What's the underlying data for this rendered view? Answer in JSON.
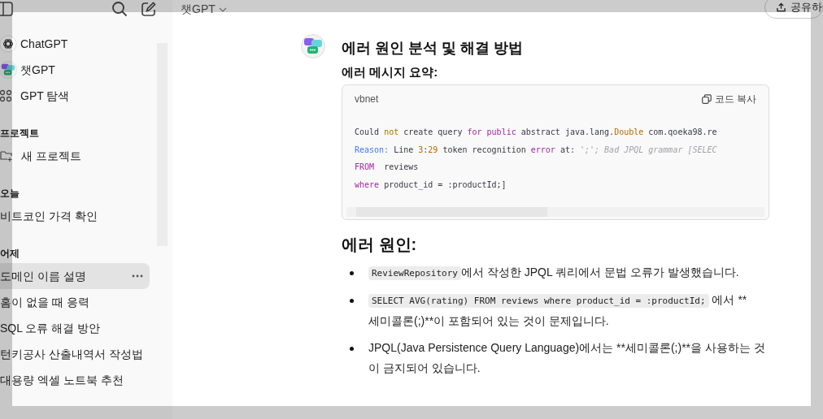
{
  "header": {
    "model": "챗GPT",
    "share": "공유하"
  },
  "sidebar": {
    "items": [
      {
        "label": "ChatGPT",
        "kind": "openai"
      },
      {
        "label": "챗GPT",
        "kind": "avatar"
      },
      {
        "label": "GPT 탐색",
        "kind": "grid"
      }
    ],
    "sections": [
      {
        "title": "프로젝트",
        "items": [
          {
            "label": "새 프로젝트",
            "kind": "folder",
            "selected": false
          }
        ]
      },
      {
        "title": "오늘",
        "items": [
          {
            "label": "비트코인 가격 확인",
            "kind": "chat",
            "selected": false
          }
        ]
      },
      {
        "title": "어제",
        "items": [
          {
            "label": "도메인 이름 설명",
            "kind": "chat",
            "selected": true
          },
          {
            "label": "홈이 없을 때 응력",
            "kind": "chat",
            "selected": false
          },
          {
            "label": "SQL 오류 해결 방안",
            "kind": "chat",
            "selected": false
          },
          {
            "label": "턴키공사 산출내역서 작성법",
            "kind": "chat",
            "selected": false
          },
          {
            "label": "대용량 엑셀 노트북 추천",
            "kind": "chat",
            "selected": false
          }
        ]
      }
    ]
  },
  "message": {
    "title": "에러 원인 분석 및 해결 방법",
    "subtitle": "에러 메시지 요약:",
    "code": {
      "language": "vbnet",
      "copy": "코드 복사",
      "lines": [
        [
          {
            "t": "Could ",
            "kind": "plain"
          },
          {
            "t": "not",
            "kind": "literal"
          },
          {
            "t": " create query ",
            "kind": "plain"
          },
          {
            "t": "for ",
            "kind": "keyword"
          },
          {
            "t": "public",
            "kind": "keyword"
          },
          {
            "t": " abstract java.lang.",
            "kind": "plain"
          },
          {
            "t": "Double",
            "kind": "literal"
          },
          {
            "t": " com.qoeka98.re",
            "kind": "plain"
          }
        ],
        [
          {
            "t": "Reason:",
            "kind": "label"
          },
          {
            "t": " Line ",
            "kind": "plain"
          },
          {
            "t": "3",
            "kind": "literal"
          },
          {
            "t": ":",
            "kind": "plain"
          },
          {
            "t": "29",
            "kind": "literal"
          },
          {
            "t": " token recognition ",
            "kind": "plain"
          },
          {
            "t": "error",
            "kind": "keyword"
          },
          {
            "t": " at: ",
            "kind": "plain"
          },
          {
            "t": "';'; Bad JPQL grammar [SELEC",
            "kind": "comment"
          }
        ],
        [
          {
            "t": "FROM",
            "kind": "keyword"
          },
          {
            "t": "  reviews",
            "kind": "plain"
          }
        ],
        [
          {
            "t": "where",
            "kind": "keyword"
          },
          {
            "t": " product_id = :productId;]",
            "kind": "plain"
          }
        ]
      ]
    },
    "section": "에러 원인:",
    "bullets": [
      {
        "lines": [
          [
            {
              "t": "ReviewRepository",
              "kind": "code"
            },
            {
              "t": "에서 작성한 JPQL 쿼리에서 문법 오류가 발생했습니다.",
              "kind": "text"
            }
          ]
        ]
      },
      {
        "lines": [
          [
            {
              "t": "SELECT AVG(rating) FROM reviews where product_id = :productId;",
              "kind": "code"
            },
            {
              "t": " 에서 **",
              "kind": "text"
            }
          ],
          [
            {
              "t": "세미콜론(;)**이 포함되어 있는 것이 문제입니다.",
              "kind": "text"
            }
          ]
        ]
      },
      {
        "lines": [
          [
            {
              "t": "JPQL(Java Persistence Query Language)에서는 **세미콜론(;)**을 사용하는 것",
              "kind": "text"
            }
          ],
          [
            {
              "t": "이 금지되어 있습니다.",
              "kind": "text"
            }
          ]
        ]
      }
    ]
  }
}
